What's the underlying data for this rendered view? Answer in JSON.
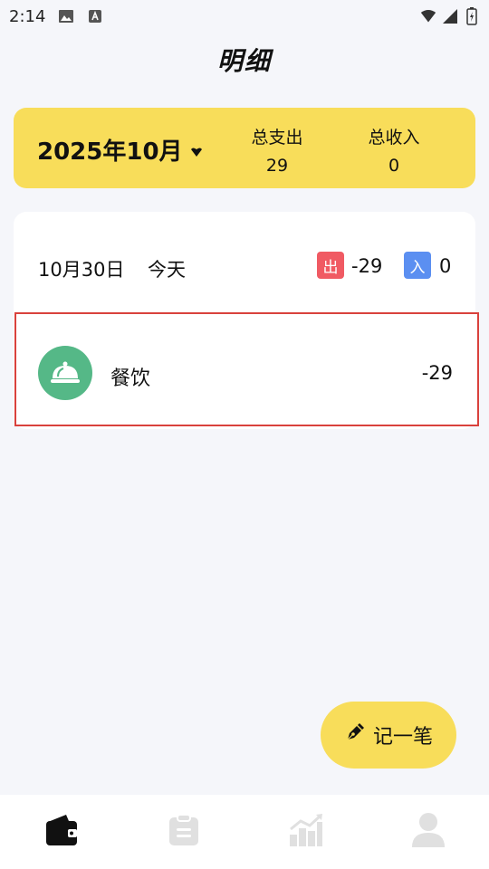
{
  "status_bar": {
    "time": "2:14"
  },
  "header": {
    "title": "明细"
  },
  "summary": {
    "month": "2025年10月",
    "expense_label": "总支出",
    "expense_value": "29",
    "income_label": "总收入",
    "income_value": "0"
  },
  "day": {
    "date": "10月30日",
    "relative": "今天",
    "out_badge": "出",
    "out_value": "-29",
    "in_badge": "入",
    "in_value": "0"
  },
  "entries": [
    {
      "category": "餐饮",
      "amount": "-29",
      "icon": "food-cloche-icon"
    }
  ],
  "fab": {
    "label": "记一笔",
    "icon": "pen-icon"
  },
  "tabs": [
    {
      "icon": "wallet-icon",
      "active": true
    },
    {
      "icon": "clipboard-icon",
      "active": false
    },
    {
      "icon": "chart-icon",
      "active": false
    },
    {
      "icon": "user-icon",
      "active": false
    }
  ],
  "colors": {
    "accent_yellow": "#f8dd5a",
    "expense_red": "#f05a63",
    "income_blue": "#5b8ff1",
    "category_green": "#55b887",
    "highlight_border": "#d9413c"
  }
}
